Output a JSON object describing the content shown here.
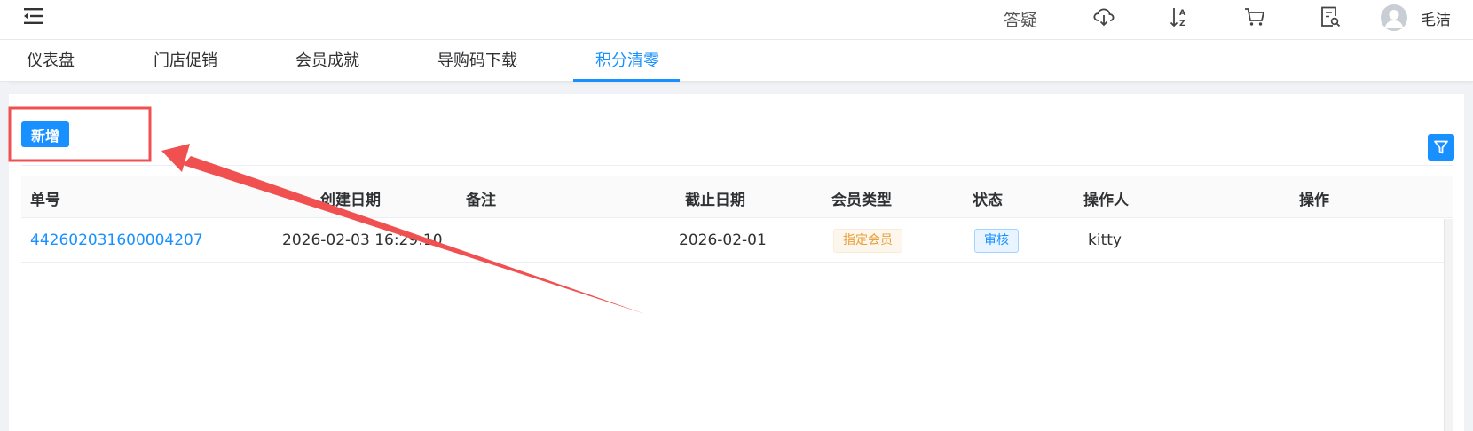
{
  "header": {
    "qa_label": "答疑",
    "icons": [
      "menu-fold-icon",
      "cloud-download-icon",
      "sort-az-icon",
      "cart-icon",
      "document-search-icon",
      "user-avatar-icon"
    ],
    "username": "毛洁"
  },
  "tabs": [
    {
      "label": "仪表盘",
      "active": false
    },
    {
      "label": "门店促销",
      "active": false
    },
    {
      "label": "会员成就",
      "active": false
    },
    {
      "label": "导购码下载",
      "active": false
    },
    {
      "label": "积分清零",
      "active": true
    }
  ],
  "toolbar": {
    "add_label": "新增",
    "filter_icon": "filter-icon"
  },
  "table": {
    "columns": [
      "单号",
      "创建日期",
      "备注",
      "截止日期",
      "会员类型",
      "状态",
      "操作人",
      "操作"
    ],
    "rows": [
      {
        "order_no": "442602031600004207",
        "created": "2026-02-03 16:29:10",
        "remark": "",
        "deadline": "2026-02-01",
        "member_type": "指定会员",
        "status": "审核",
        "operator": "kitty",
        "action": ""
      }
    ]
  },
  "colors": {
    "primary": "#1890ff",
    "annotation": "#f05050",
    "warning_tag_text": "#e6a23c"
  }
}
